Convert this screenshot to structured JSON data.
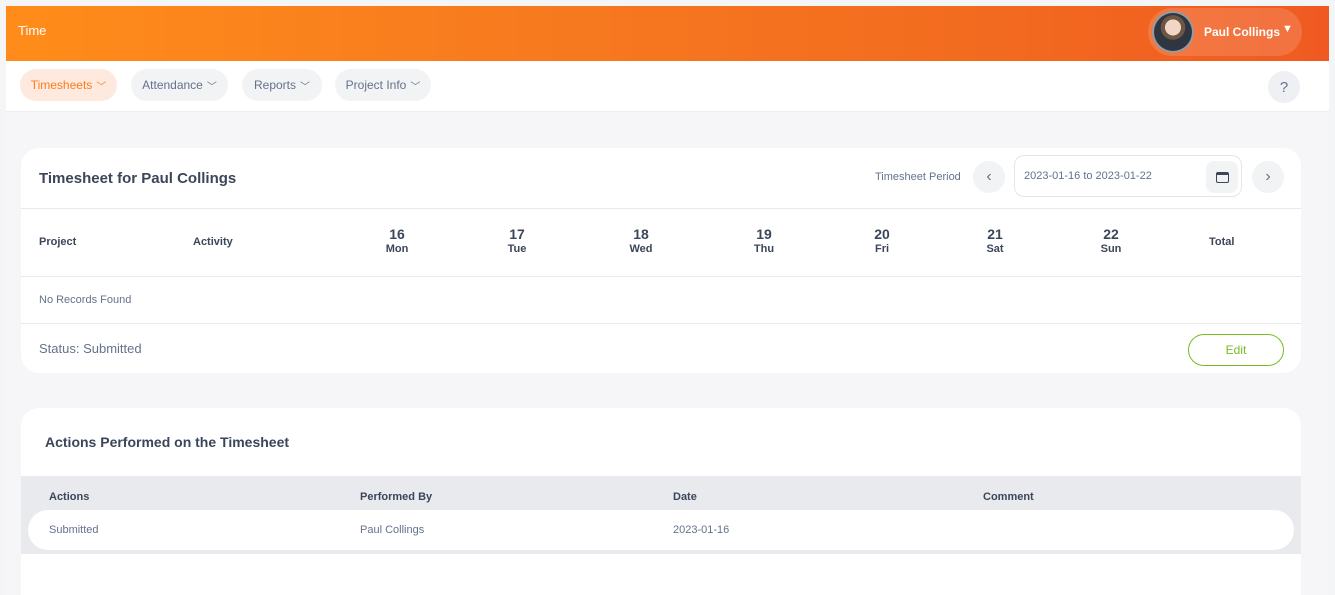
{
  "header": {
    "module_title": "Time",
    "user_name": "Paul Collings"
  },
  "nav": {
    "items": [
      {
        "label": "Timesheets",
        "active": true
      },
      {
        "label": "Attendance",
        "active": false
      },
      {
        "label": "Reports",
        "active": false
      },
      {
        "label": "Project Info",
        "active": false
      }
    ],
    "help": "?"
  },
  "timesheet": {
    "title": "Timesheet for Paul Collings",
    "period_label": "Timesheet Period",
    "period_value": "2023-01-16 to 2023-01-22",
    "columns": {
      "project": "Project",
      "activity": "Activity",
      "total": "Total"
    },
    "days": [
      {
        "num": "16",
        "name": "Mon"
      },
      {
        "num": "17",
        "name": "Tue"
      },
      {
        "num": "18",
        "name": "Wed"
      },
      {
        "num": "19",
        "name": "Thu"
      },
      {
        "num": "20",
        "name": "Fri"
      },
      {
        "num": "21",
        "name": "Sat"
      },
      {
        "num": "22",
        "name": "Sun"
      }
    ],
    "no_records": "No Records Found",
    "status": "Status: Submitted",
    "edit_label": "Edit"
  },
  "actions": {
    "title": "Actions Performed on the Timesheet",
    "headers": {
      "actions": "Actions",
      "performed_by": "Performed By",
      "date": "Date",
      "comment": "Comment"
    },
    "rows": [
      {
        "action": "Submitted",
        "performed_by": "Paul Collings",
        "date": "2023-01-16",
        "comment": ""
      }
    ]
  },
  "colors": {
    "accent": "#ff7b1d",
    "edit": "#76bc21",
    "text": "#64728c"
  }
}
